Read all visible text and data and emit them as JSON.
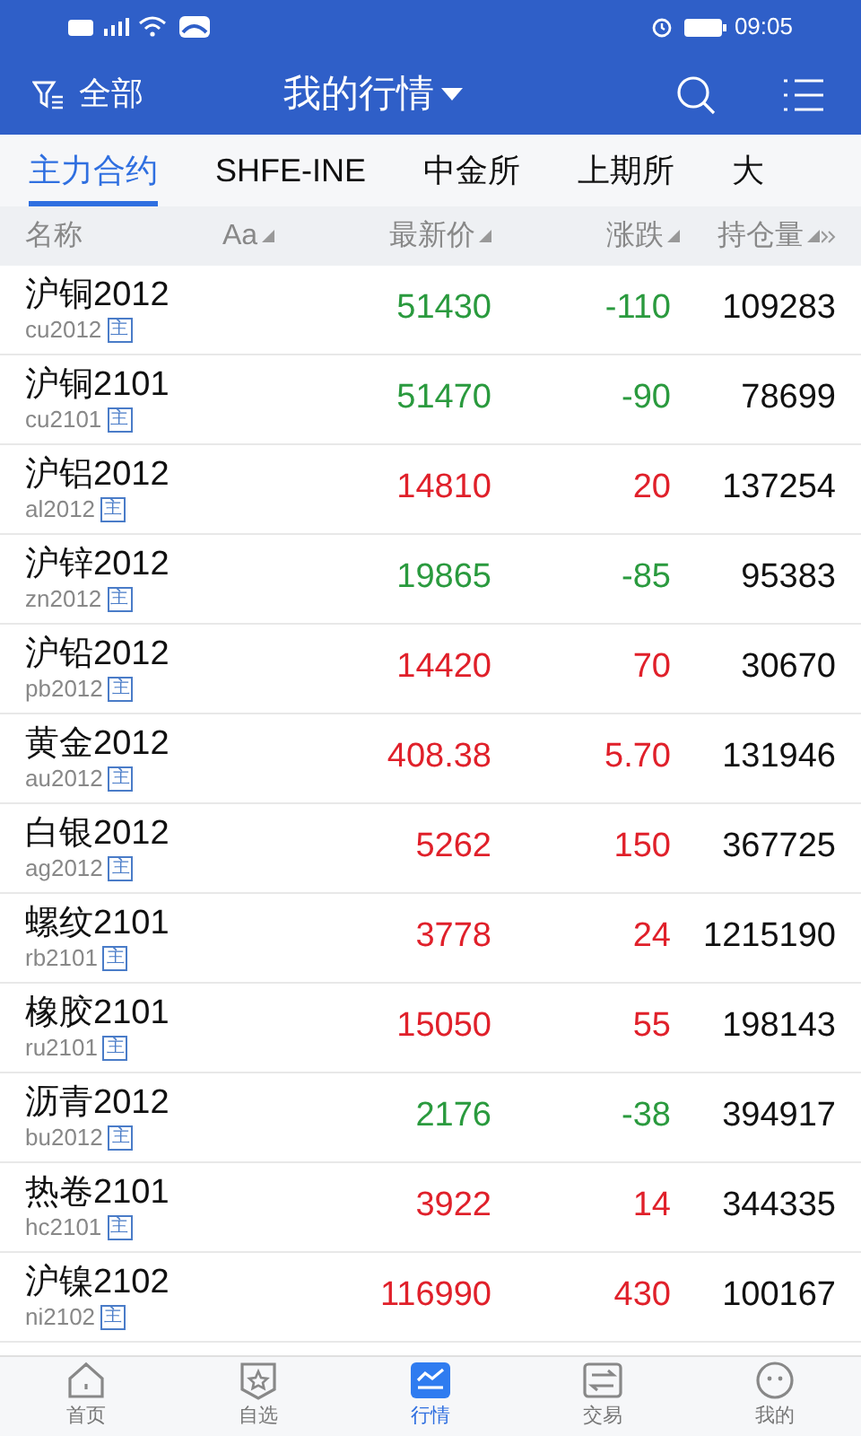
{
  "status_bar": {
    "time": "09:05"
  },
  "header": {
    "filter_label": "全部",
    "title": "我的行情"
  },
  "tabs": [
    {
      "label": "主力合约",
      "selected": true
    },
    {
      "label": "SHFE-INE",
      "selected": false
    },
    {
      "label": "中金所",
      "selected": false
    },
    {
      "label": "上期所",
      "selected": false
    },
    {
      "label": "大",
      "selected": false
    }
  ],
  "table": {
    "columns": [
      {
        "label": "名称",
        "sortable": false
      },
      {
        "label": "Aa",
        "sortable": true
      },
      {
        "label": "最新价",
        "sortable": true
      },
      {
        "label": "涨跌",
        "sortable": true
      },
      {
        "label": "持仓量",
        "sortable": true
      }
    ],
    "rows": [
      {
        "name": "沪铜2012",
        "code": "cu2012",
        "badge": "主",
        "price": "51430",
        "change": "-110",
        "open_interest": "109283",
        "rising": false
      },
      {
        "name": "沪铜2101",
        "code": "cu2101",
        "badge": "主",
        "price": "51470",
        "change": "-90",
        "open_interest": "78699",
        "rising": false
      },
      {
        "name": "沪铝2012",
        "code": "al2012",
        "badge": "主",
        "price": "14810",
        "change": "20",
        "open_interest": "137254",
        "rising": true
      },
      {
        "name": "沪锌2012",
        "code": "zn2012",
        "badge": "主",
        "price": "19865",
        "change": "-85",
        "open_interest": "95383",
        "rising": false
      },
      {
        "name": "沪铅2012",
        "code": "pb2012",
        "badge": "主",
        "price": "14420",
        "change": "70",
        "open_interest": "30670",
        "rising": true
      },
      {
        "name": "黄金2012",
        "code": "au2012",
        "badge": "主",
        "price": "408.38",
        "change": "5.70",
        "open_interest": "131946",
        "rising": true
      },
      {
        "name": "白银2012",
        "code": "ag2012",
        "badge": "主",
        "price": "5262",
        "change": "150",
        "open_interest": "367725",
        "rising": true
      },
      {
        "name": "螺纹2101",
        "code": "rb2101",
        "badge": "主",
        "price": "3778",
        "change": "24",
        "open_interest": "1215190",
        "rising": true
      },
      {
        "name": "橡胶2101",
        "code": "ru2101",
        "badge": "主",
        "price": "15050",
        "change": "55",
        "open_interest": "198143",
        "rising": true
      },
      {
        "name": "沥青2012",
        "code": "bu2012",
        "badge": "主",
        "price": "2176",
        "change": "-38",
        "open_interest": "394917",
        "rising": false
      },
      {
        "name": "热卷2101",
        "code": "hc2101",
        "badge": "主",
        "price": "3922",
        "change": "14",
        "open_interest": "344335",
        "rising": true
      },
      {
        "name": "沪镍2102",
        "code": "ni2102",
        "badge": "主",
        "price": "116990",
        "change": "430",
        "open_interest": "100167",
        "rising": true
      }
    ]
  },
  "bottom_nav": [
    {
      "label": "首页",
      "kind": "home",
      "selected": false
    },
    {
      "label": "自选",
      "kind": "watchlist",
      "selected": false
    },
    {
      "label": "行情",
      "kind": "market",
      "selected": true
    },
    {
      "label": "交易",
      "kind": "trade",
      "selected": false
    },
    {
      "label": "我的",
      "kind": "profile",
      "selected": false
    }
  ]
}
